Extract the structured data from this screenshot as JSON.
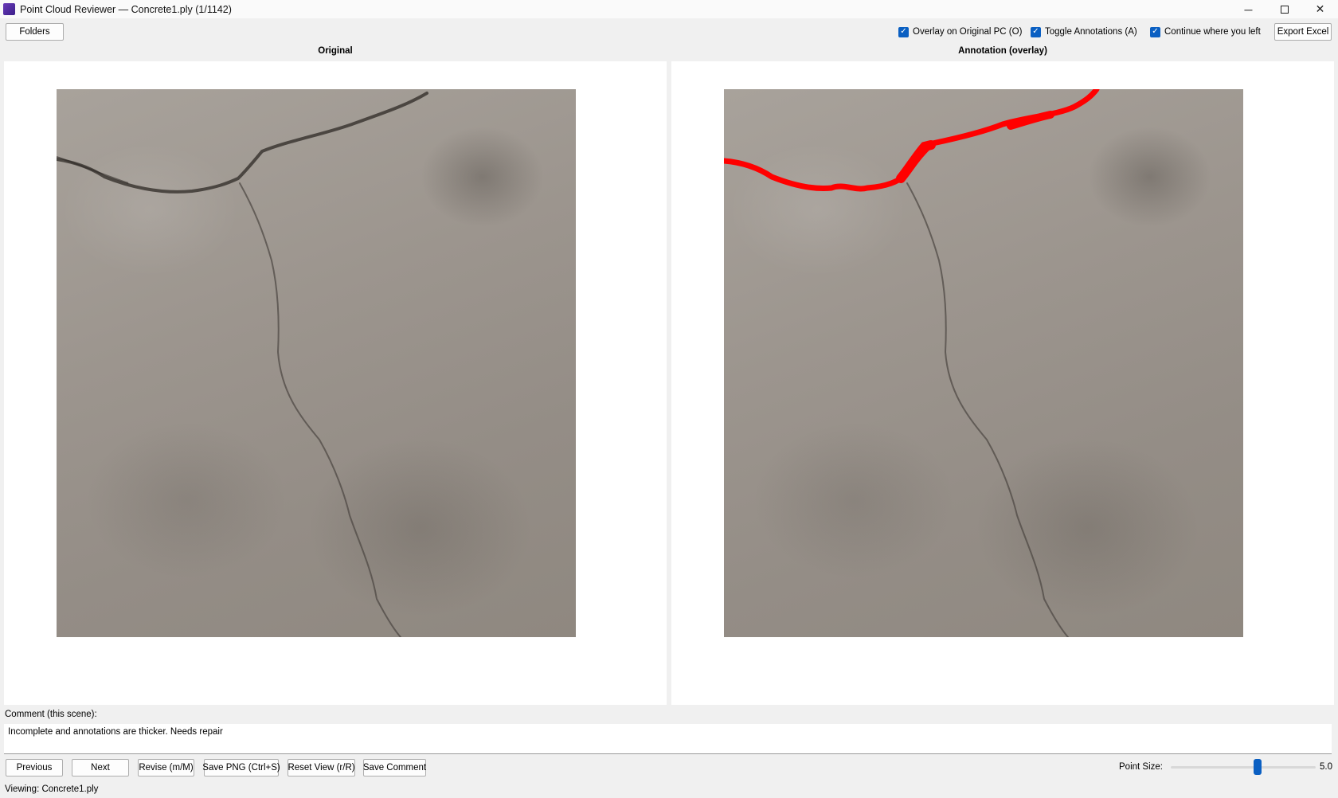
{
  "window": {
    "title": "Point Cloud Reviewer — Concrete1.ply   (1/1142)",
    "controls": {
      "minimize": "─",
      "close": "✕"
    }
  },
  "toolbar": {
    "folders_label": "Folders",
    "overlay_label": "Overlay on Original PC (O)",
    "overlay_checked": true,
    "toggle_label": "Toggle Annotations (A)",
    "toggle_checked": true,
    "continue_label": "Continue where you left",
    "continue_checked": true,
    "export_label": "Export Excel"
  },
  "panels": {
    "original_title": "Original",
    "annotation_title": "Annotation (overlay)",
    "annotation_color": "#ff0000"
  },
  "comment": {
    "label": "Comment (this scene):",
    "value": "Incomplete and annotations are thicker. Needs repair"
  },
  "actions": {
    "previous": "Previous",
    "next": "Next",
    "revise": "Revise (m/M)",
    "save_png": "Save PNG (Ctrl+S)",
    "reset_view": "Reset View (r/R)",
    "save_comment": "Save Comment"
  },
  "point_size": {
    "label": "Point Size:",
    "value": "5.0",
    "level": 0.6
  },
  "status": {
    "text": "Viewing: Concrete1.ply"
  }
}
